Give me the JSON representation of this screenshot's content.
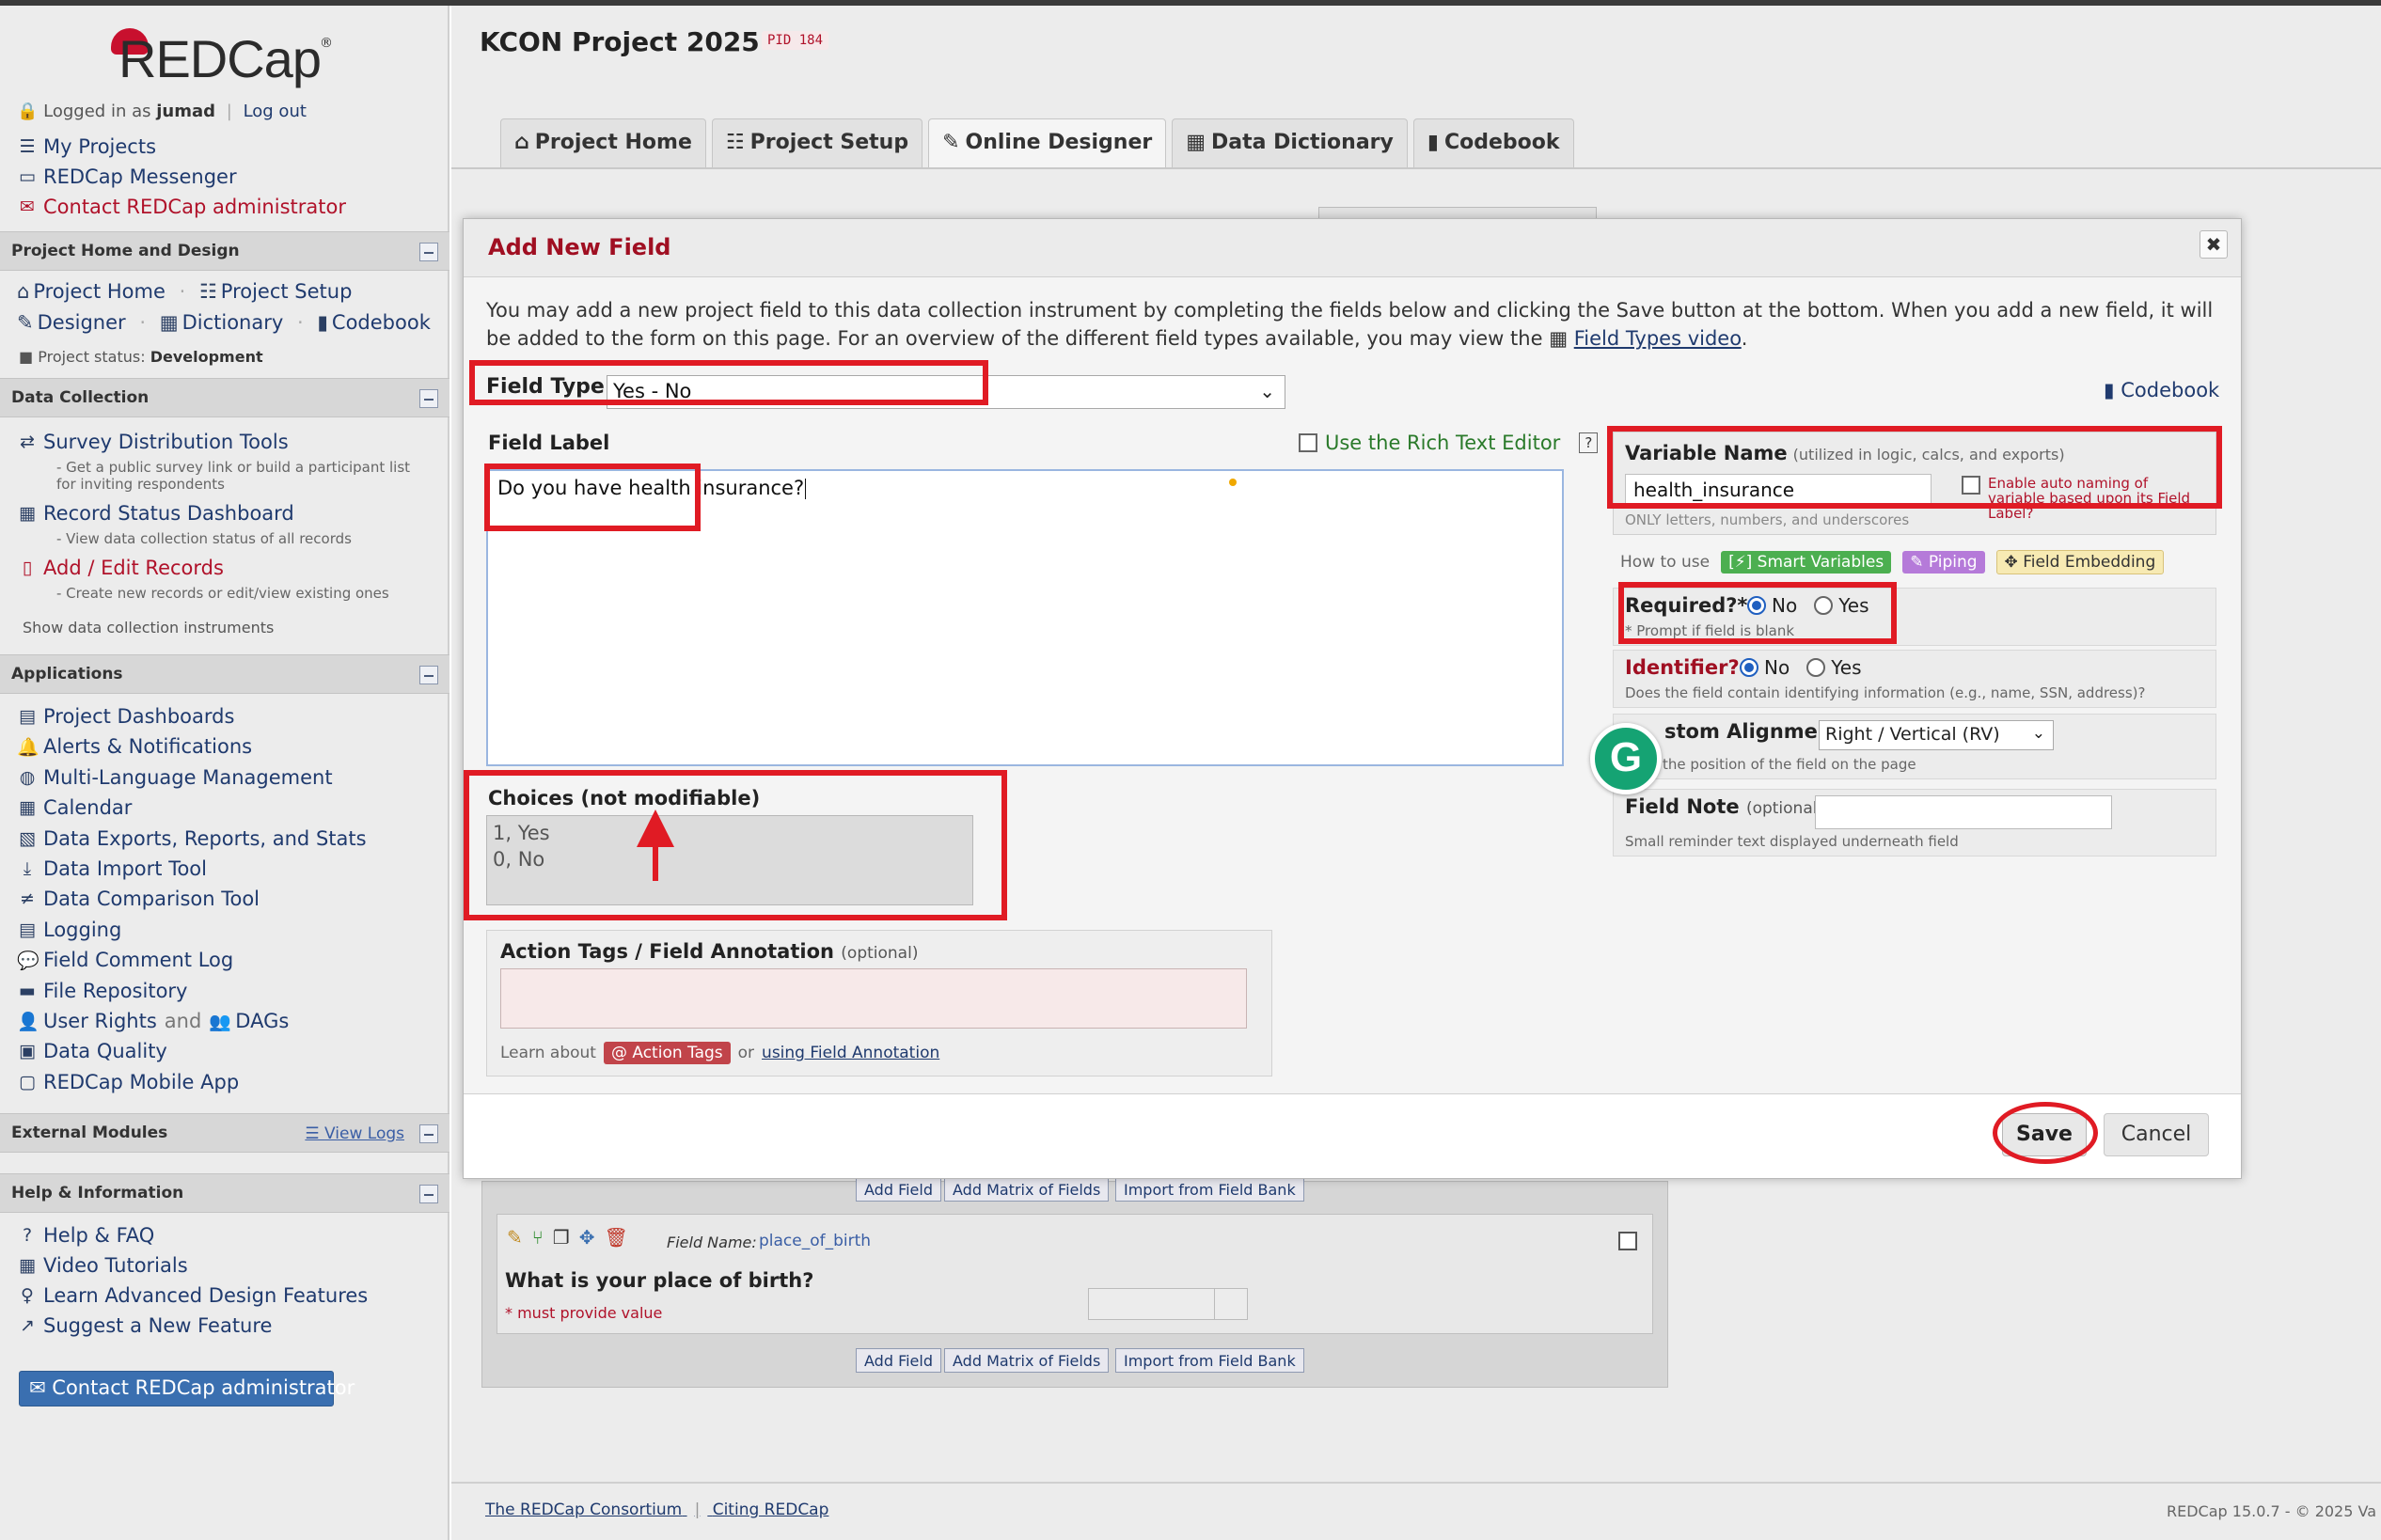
{
  "app": {
    "logo_text": "REDCap",
    "logo_reg": "®"
  },
  "sidebar": {
    "logged_in_prefix": "Logged in as",
    "username": "jumad",
    "logout": "Log out",
    "top_links": {
      "my_projects": "My Projects",
      "messenger": "REDCap Messenger",
      "contact_admin": "Contact REDCap administrator"
    },
    "sections": {
      "project_home_design": "Project Home and Design",
      "data_collection": "Data Collection",
      "applications": "Applications",
      "external_modules": "External Modules",
      "help_info": "Help & Information"
    },
    "project_home": "Project Home",
    "project_setup": "Project Setup",
    "designer": "Designer",
    "dictionary": "Dictionary",
    "codebook": "Codebook",
    "project_status_label": "Project status:",
    "project_status_value": "Development",
    "data_collection": {
      "survey_tools": "Survey Distribution Tools",
      "survey_tools_sub": "- Get a public survey link or build a participant list for inviting respondents",
      "record_status": "Record Status Dashboard",
      "record_status_sub": "- View data collection status of all records",
      "add_edit": "Add / Edit Records",
      "add_edit_sub": "- Create new records or edit/view existing ones",
      "show_instruments": "Show data collection instruments"
    },
    "applications": {
      "dashboards": "Project Dashboards",
      "alerts": "Alerts & Notifications",
      "multilang": "Multi-Language Management",
      "calendar": "Calendar",
      "exports": "Data Exports, Reports, and Stats",
      "import": "Data Import Tool",
      "comparison": "Data Comparison Tool",
      "logging": "Logging",
      "comment_log": "Field Comment Log",
      "file_repo": "File Repository",
      "user_rights": "User Rights",
      "and": "and",
      "dags": "DAGs",
      "data_quality": "Data Quality",
      "mobile_app": "REDCap Mobile App"
    },
    "view_logs": "View Logs",
    "help": {
      "faq": "Help & FAQ",
      "videos": "Video Tutorials",
      "advanced": "Learn Advanced Design Features",
      "suggest": "Suggest a New Feature"
    },
    "contact_button": "Contact REDCap administrator"
  },
  "main": {
    "project_title": "KCON Project 2025",
    "pid": "PID 184",
    "tabs": [
      {
        "label": "Project Home",
        "icon": "home-icon"
      },
      {
        "label": "Project Setup",
        "icon": "checklist-icon"
      },
      {
        "label": "Online Designer",
        "icon": "edit-icon"
      },
      {
        "label": "Data Dictionary",
        "icon": "spreadsheet-icon"
      },
      {
        "label": "Codebook",
        "icon": "book-icon"
      }
    ],
    "below": {
      "add_field": "Add Field",
      "add_matrix": "Add Matrix of Fields",
      "import_bank": "Import from Field Bank",
      "field_name_label": "Field Name:",
      "field_name_value": "place_of_birth",
      "question": "What is your place of birth?",
      "must_provide": "* must provide value"
    },
    "footer": {
      "consortium": "The REDCap Consortium",
      "citing": "Citing REDCap",
      "version": "REDCap 15.0.7  -  © 2025 Va"
    }
  },
  "dialog": {
    "title": "Add New Field",
    "intro": "You may add a new project field to this data collection instrument by completing the fields below and clicking the Save button at the bottom. When you add a new field, it will be added to the form on this page. For an overview of the different field types available, you may view the",
    "intro_link": "Field Types video",
    "field_type_label": "Field Type:",
    "field_type_value": "Yes - No",
    "codebook_link": "Codebook",
    "field_label_title": "Field Label",
    "rich_text": "Use the Rich Text Editor",
    "field_label_value": "Do you have health insurance?",
    "choices_title": "Choices (not modifiable)",
    "choices": [
      "1, Yes",
      "0, No"
    ],
    "action_tags_title": "Action Tags / Field Annotation",
    "optional": "(optional)",
    "learn_about": "Learn about",
    "action_tags_btn": "@ Action Tags",
    "or": "or",
    "using_annotation": "using Field Annotation",
    "variable_name_title": "Variable Name",
    "variable_name_hint": "(utilized in logic, calcs, and exports)",
    "variable_name_value": "health_insurance",
    "auto_naming": "Enable auto naming of variable based upon its Field Label?",
    "only_letters": "ONLY letters, numbers, and underscores",
    "how_to_use": "How to use",
    "smart_vars": "[⚡] Smart Variables",
    "piping": "Piping",
    "embedding": "Field Embedding",
    "required_title": "Required?*",
    "required_sub": "* Prompt if field is blank",
    "no": "No",
    "yes": "Yes",
    "identifier_title": "Identifier?",
    "identifier_sub": "Does the field contain identifying information (e.g., name, SSN, address)?",
    "alignment_title": "stom Alignment",
    "alignment_value": "Right / Vertical (RV)",
    "alignment_sub": "the position of the field on the page",
    "field_note_title": "Field Note",
    "field_note_sub": "Small reminder text displayed underneath field",
    "save": "Save",
    "cancel": "Cancel",
    "grammarly": "G"
  }
}
